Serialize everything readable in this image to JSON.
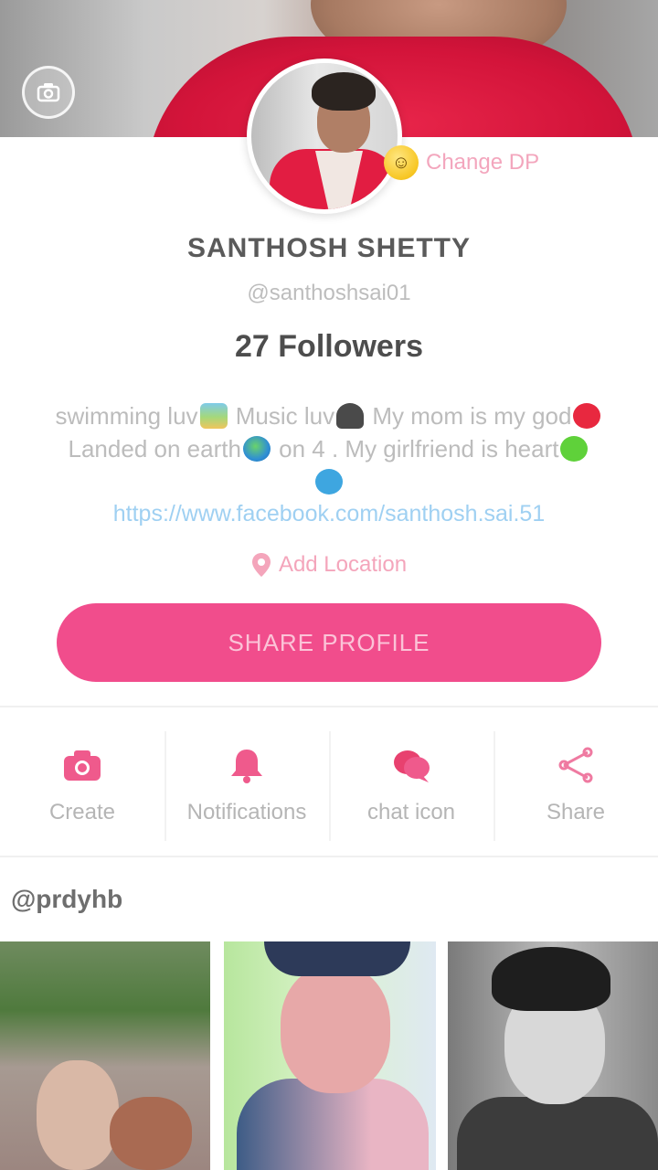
{
  "profile": {
    "name": "SANTHOSH SHETTY",
    "handle": "@santhoshsai01",
    "followers": "27 Followers",
    "change_dp": "Change DP",
    "bio_line1_a": "swimming luv",
    "bio_line1_b": " Music luv",
    "bio_line1_c": " My mom is my god",
    "bio_line2_a": "Landed on earth",
    "bio_line2_b": " on 4 . My girlfriend is heart",
    "link": "https://www.facebook.com/santhosh.sai.51",
    "location": "Add Location",
    "share_button": "SHARE PROFILE"
  },
  "actions": [
    {
      "label": "Create",
      "icon": "camera-icon"
    },
    {
      "label": "Notifications",
      "icon": "bell-icon"
    },
    {
      "label": "chat icon",
      "icon": "chat-icon"
    },
    {
      "label": "Share",
      "icon": "share-icon"
    }
  ],
  "videos": {
    "title": "@prdyhb"
  },
  "colors": {
    "accent": "#f14d8c",
    "accent_light": "#f4a5bb",
    "link": "#9fd0f2"
  }
}
